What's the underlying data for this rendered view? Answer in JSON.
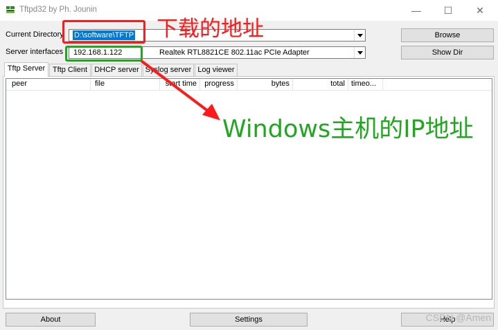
{
  "window": {
    "title": "Tftpd32 by Ph. Jounin",
    "minimize_glyph": "—",
    "maximize_glyph": "☐",
    "close_glyph": "✕"
  },
  "fields": {
    "current_directory_label": "Current Directory",
    "current_directory_value": "D:\\software\\TFTP",
    "server_interfaces_label": "Server interfaces",
    "server_ip": "192.168.1.122",
    "server_adapter": "Realtek RTL8821CE 802.11ac PCIe Adapter"
  },
  "buttons": {
    "browse": "Browse",
    "show_dir": "Show Dir",
    "about": "About",
    "settings": "Settings",
    "help": "Help"
  },
  "tabs": [
    {
      "label": "Tftp Server",
      "active": true
    },
    {
      "label": "Tftp Client",
      "active": false
    },
    {
      "label": "DHCP server",
      "active": false
    },
    {
      "label": "Syslog server",
      "active": false
    },
    {
      "label": "Log viewer",
      "active": false
    }
  ],
  "table": {
    "columns": [
      "peer",
      "file",
      "start time",
      "progress",
      "bytes",
      "total",
      "timeo..."
    ]
  },
  "annotations": {
    "download_address": "下载的地址",
    "windows_ip": "Windows主机的IP地址",
    "red_color": "#ff1a1a",
    "green_color": "#1fa71f"
  },
  "watermark": "CSDN @Amen"
}
